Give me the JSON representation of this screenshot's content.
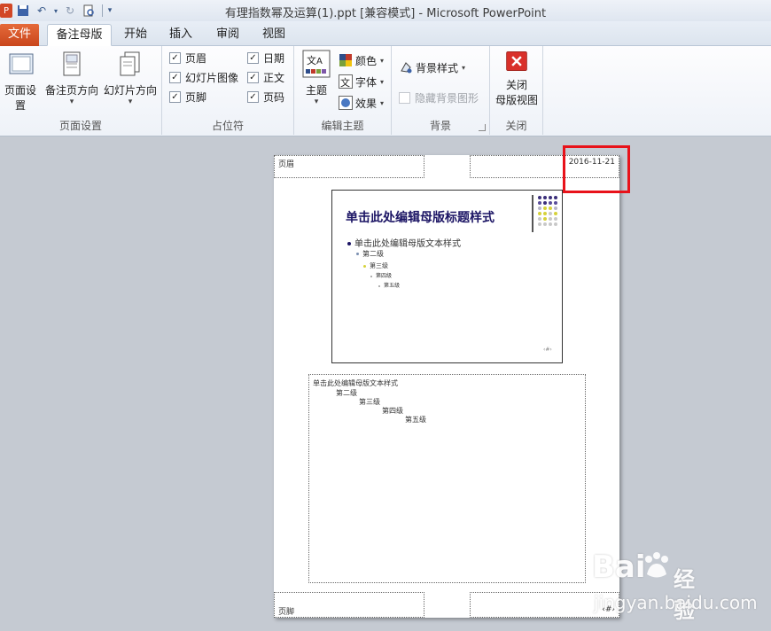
{
  "window": {
    "title": "有理指数幂及运算(1).ppt [兼容模式] - Microsoft PowerPoint"
  },
  "tabs": [
    {
      "label": "文件"
    },
    {
      "label": "备注母版"
    },
    {
      "label": "开始"
    },
    {
      "label": "插入"
    },
    {
      "label": "审阅"
    },
    {
      "label": "视图"
    }
  ],
  "ribbon": {
    "page_setup": {
      "label": "页面设置",
      "buttons": [
        "页面设置",
        "备注页方向",
        "幻灯片方向"
      ]
    },
    "placeholders": {
      "label": "占位符",
      "checks": [
        {
          "label": "页眉",
          "checked": true
        },
        {
          "label": "日期",
          "checked": true
        },
        {
          "label": "幻灯片图像",
          "checked": true
        },
        {
          "label": "正文",
          "checked": true
        },
        {
          "label": "页脚",
          "checked": true
        },
        {
          "label": "页码",
          "checked": true
        }
      ]
    },
    "edit_theme": {
      "label": "编辑主题",
      "theme": "主题",
      "colors": "颜色",
      "fonts": "字体",
      "effects": "效果"
    },
    "background": {
      "label": "背景",
      "styles": "背景样式",
      "hide_graphics": "隐藏背景图形"
    },
    "close": {
      "label": "关闭",
      "button_line1": "关闭",
      "button_line2": "母版视图"
    }
  },
  "notes_page": {
    "header": "页眉",
    "date": "2016-11-21",
    "footer": "页脚",
    "page_number": "‹#›",
    "slide": {
      "title": "单击此处编辑母版标题样式",
      "levels": [
        "单击此处编辑母版文本样式",
        "第二级",
        "第三级",
        "第四级",
        "第五级"
      ],
      "slide_number": "‹#›"
    },
    "notes": [
      "单击此处编辑母版文本样式",
      "第二级",
      "第三级",
      "第四级",
      "第五级"
    ]
  },
  "watermark": {
    "brand": "Bai",
    "brand2": "经验",
    "url": "jingyan.baidu.com"
  },
  "colors": {
    "highlight": "#e8121a",
    "file_tab": "#d4552a",
    "title": "#1b1464"
  }
}
